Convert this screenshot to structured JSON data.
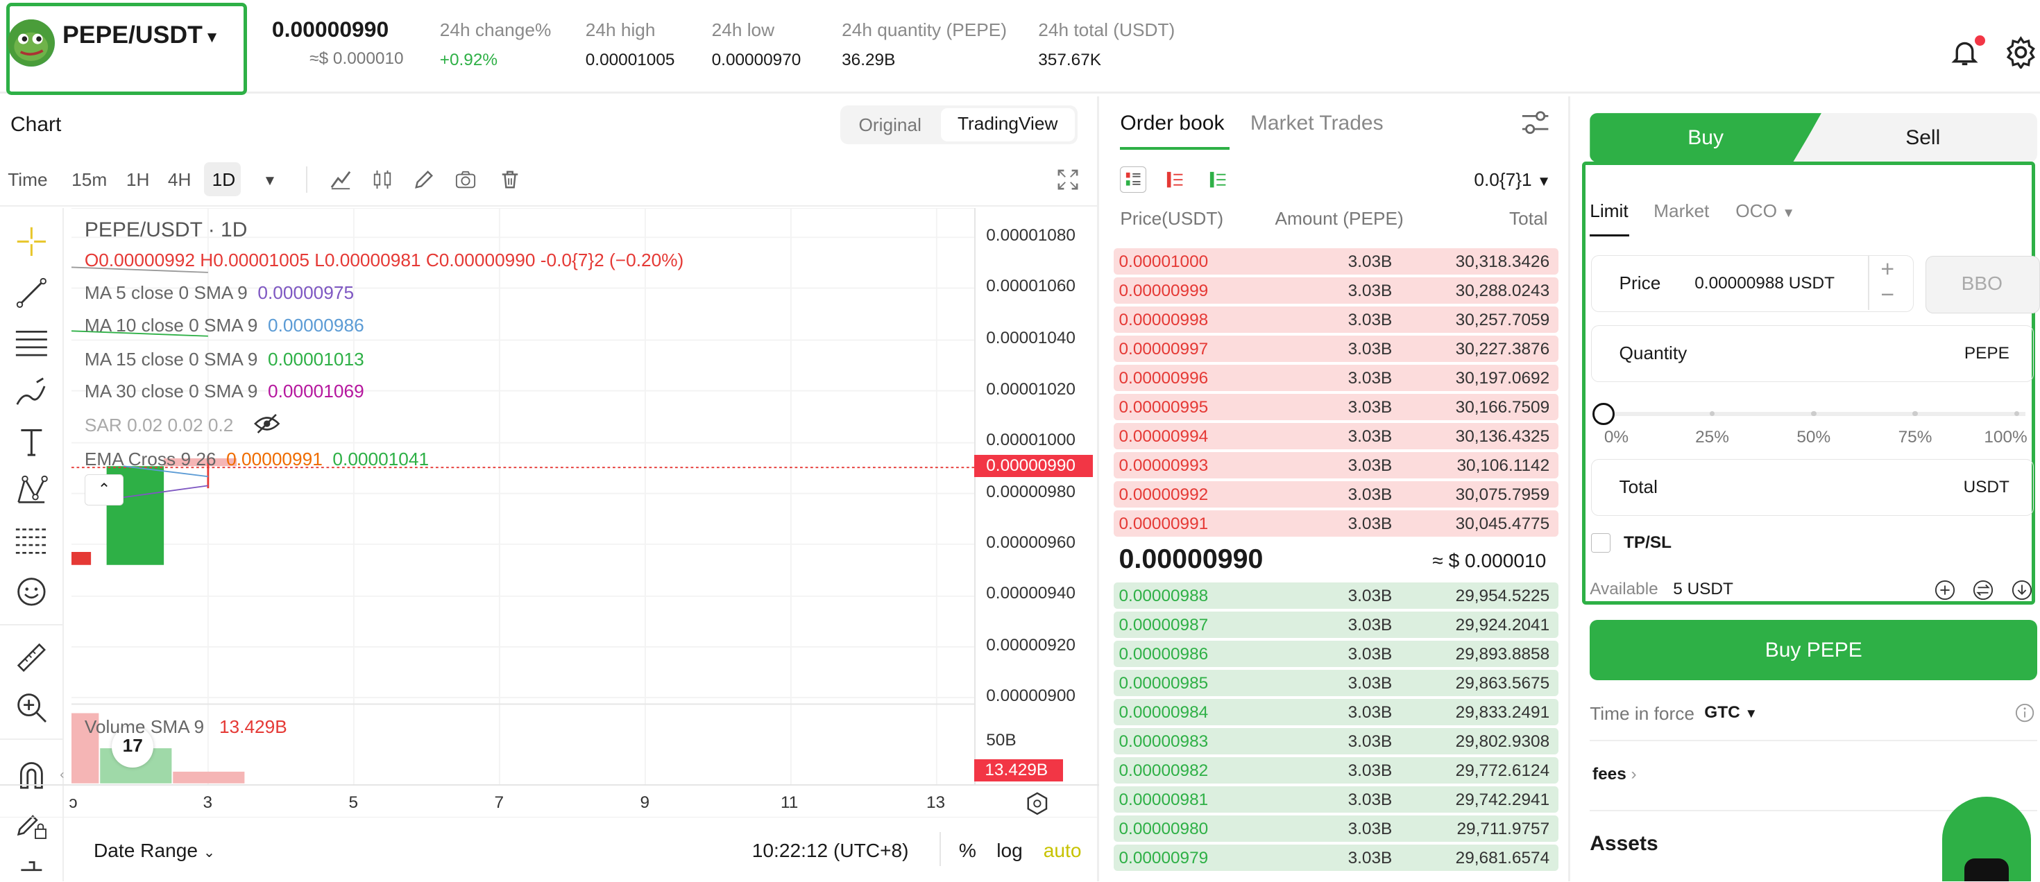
{
  "header": {
    "pair": "PEPE/USDT",
    "last_price": "0.00000990",
    "last_price_usd": "≈$ 0.000010",
    "stats": [
      {
        "label": "24h change%",
        "value": "+0.92%"
      },
      {
        "label": "24h high",
        "value": "0.00001005"
      },
      {
        "label": "24h low",
        "value": "0.00000970"
      },
      {
        "label": "24h quantity (PEPE)",
        "value": "36.29B"
      },
      {
        "label": "24h total (USDT)",
        "value": "357.67K"
      }
    ]
  },
  "chart": {
    "title": "Chart",
    "view_original": "Original",
    "view_tradingview": "TradingView",
    "timeframes": [
      "Time",
      "15m",
      "1H",
      "4H",
      "1D"
    ],
    "symbol_label": "PEPE/USDT · 1D",
    "ohlc": {
      "o": "O0.00000992",
      "h": "H0.00001005",
      "l": "L0.00000981",
      "c": "C0.00000990",
      "chg": "-0.0{7}2 (−0.20%)"
    },
    "studies": [
      {
        "name": "MA 5 close 0 SMA 9",
        "value": "0.00000975",
        "color": "#7e57c2"
      },
      {
        "name": "MA 10 close 0 SMA 9",
        "value": "0.00000986",
        "color": "#5b9bd5"
      },
      {
        "name": "MA 15 close 0 SMA 9",
        "value": "0.00001013",
        "color": "#2eb046"
      },
      {
        "name": "MA 30 close 0 SMA 9",
        "value": "0.00001069",
        "color": "#b5179e"
      },
      {
        "name": "SAR 0.02 0.02 0.2",
        "value": "",
        "color": "#999999"
      }
    ],
    "ema": {
      "name": "EMA Cross 9 26",
      "v1": "0.00000991",
      "v2": "0.00001041"
    },
    "y_axis": [
      "0.00001080",
      "0.00001060",
      "0.00001040",
      "0.00001020",
      "0.00001000",
      "0.00000980",
      "0.00000960",
      "0.00000940",
      "0.00000920",
      "0.00000900"
    ],
    "current_price_tag": "0.00000990",
    "volume": {
      "name": "Volume SMA 9",
      "value": "13.429B",
      "axis": "50B",
      "tag": "13.429B"
    },
    "x_axis": [
      "ɔ",
      "3",
      "5",
      "7",
      "9",
      "11",
      "13"
    ],
    "date_range": "Date Range",
    "clock": "10:22:12 (UTC+8)",
    "pct": "%",
    "log": "log",
    "auto": "auto"
  },
  "orderbook": {
    "tab_book": "Order book",
    "tab_trades": "Market Trades",
    "precision": "0.0{7}1",
    "headers": [
      "Price(USDT)",
      "Amount (PEPE)",
      "Total"
    ],
    "asks": [
      [
        "0.00001000",
        "3.03B",
        "30,318.3426"
      ],
      [
        "0.00000999",
        "3.03B",
        "30,288.0243"
      ],
      [
        "0.00000998",
        "3.03B",
        "30,257.7059"
      ],
      [
        "0.00000997",
        "3.03B",
        "30,227.3876"
      ],
      [
        "0.00000996",
        "3.03B",
        "30,197.0692"
      ],
      [
        "0.00000995",
        "3.03B",
        "30,166.7509"
      ],
      [
        "0.00000994",
        "3.03B",
        "30,136.4325"
      ],
      [
        "0.00000993",
        "3.03B",
        "30,106.1142"
      ],
      [
        "0.00000992",
        "3.03B",
        "30,075.7959"
      ],
      [
        "0.00000991",
        "3.03B",
        "30,045.4775"
      ]
    ],
    "mid_price": "0.00000990",
    "mid_usd": "≈ $ 0.000010",
    "bids": [
      [
        "0.00000988",
        "3.03B",
        "29,954.5225"
      ],
      [
        "0.00000987",
        "3.03B",
        "29,924.2041"
      ],
      [
        "0.00000986",
        "3.03B",
        "29,893.8858"
      ],
      [
        "0.00000985",
        "3.03B",
        "29,863.5675"
      ],
      [
        "0.00000984",
        "3.03B",
        "29,833.2491"
      ],
      [
        "0.00000983",
        "3.03B",
        "29,802.9308"
      ],
      [
        "0.00000982",
        "3.03B",
        "29,772.6124"
      ],
      [
        "0.00000981",
        "3.03B",
        "29,742.2941"
      ],
      [
        "0.00000980",
        "3.03B",
        "29,711.9757"
      ],
      [
        "0.00000979",
        "3.03B",
        "29,681.6574"
      ]
    ]
  },
  "trade": {
    "buy_tab": "Buy",
    "sell_tab": "Sell",
    "order_types": [
      "Limit",
      "Market",
      "OCO"
    ],
    "price_label": "Price",
    "price_value": "0.00000988 USDT",
    "bbo": "BBO",
    "quantity_label": "Quantity",
    "quantity_unit": "PEPE",
    "slider_marks": [
      "0%",
      "25%",
      "50%",
      "75%",
      "100%"
    ],
    "total_label": "Total",
    "total_unit": "USDT",
    "tpsl": "TP/SL",
    "available_label": "Available",
    "available_value": "5 USDT",
    "buy_button": "Buy PEPE",
    "tif_label": "Time in force",
    "tif_value": "GTC",
    "fees": "fees",
    "assets": "Assets"
  },
  "colors": {
    "accent": "#2eb046",
    "down": "#e53935",
    "highlight": "#2eb046"
  }
}
